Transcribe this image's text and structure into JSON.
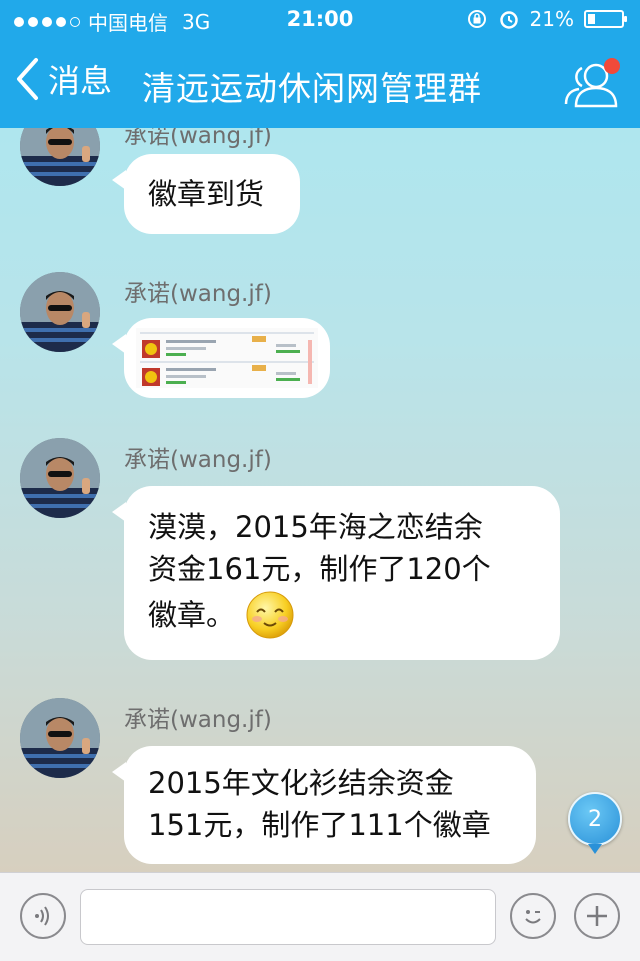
{
  "status_bar": {
    "carrier": "中国电信",
    "network": "3G",
    "time": "21:00",
    "battery": "21%",
    "battery_level": 0.21
  },
  "nav": {
    "back_label": "消息",
    "title": "清远运动休闲网管理群",
    "accent_color": "#21a9ea"
  },
  "messages": [
    {
      "sender": "承诺(wang.jf)",
      "type": "text",
      "text": "徽章到货"
    },
    {
      "sender": "承诺(wang.jf)",
      "type": "image"
    },
    {
      "sender": "承诺(wang.jf)",
      "type": "text",
      "lines": [
        "漠漠，2015年海之恋结余",
        "资金161元，制作了120个",
        "徽章。"
      ],
      "emoji": "smile-emoji"
    },
    {
      "sender": "承诺(wang.jf)",
      "type": "text",
      "lines": [
        "2015年文化衫结余资金",
        "151元，制作了111个徽章"
      ]
    }
  ],
  "unread_badge": "2",
  "input_bar": {
    "placeholder": "",
    "icons": [
      "voice-icon",
      "emoji-icon",
      "plus-icon"
    ]
  }
}
